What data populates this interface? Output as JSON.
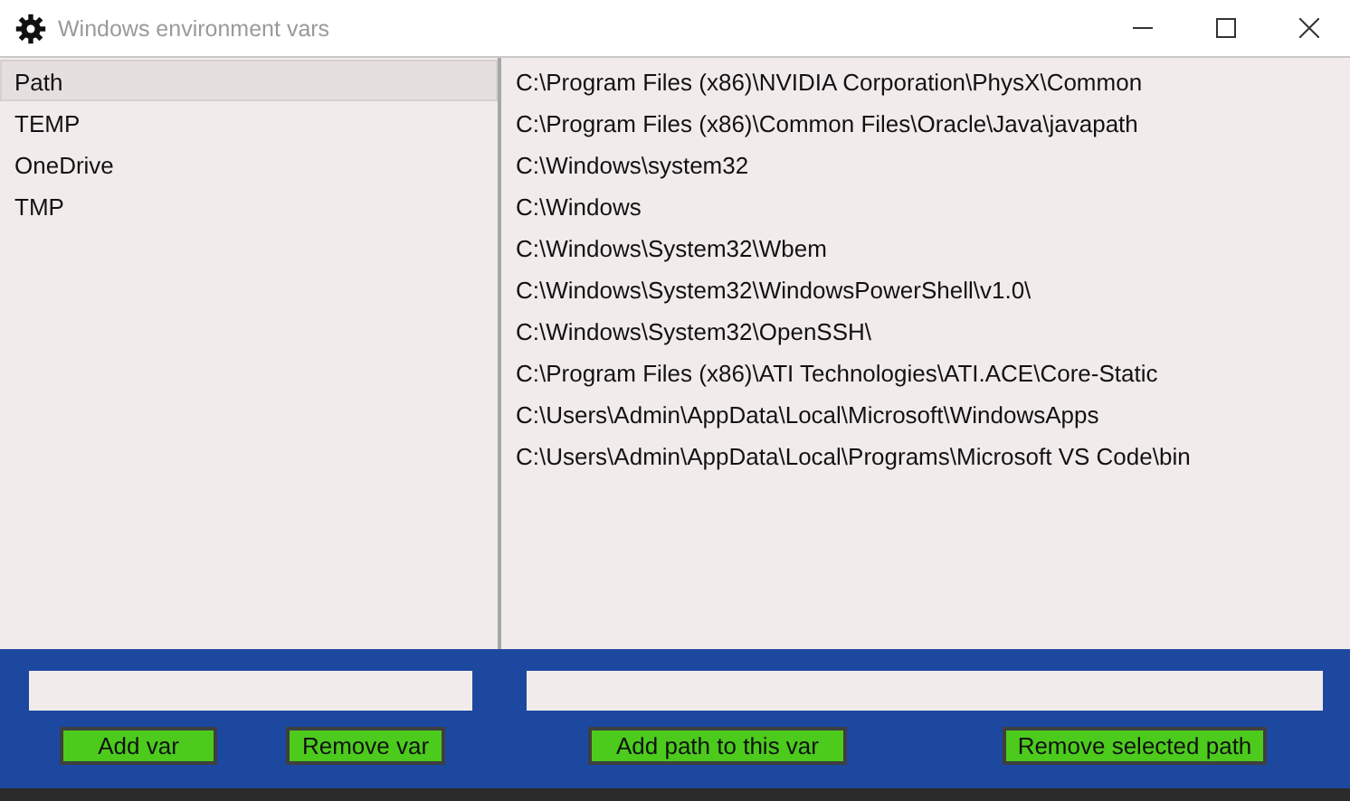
{
  "window": {
    "title": "Windows environment vars"
  },
  "variables": [
    {
      "name": "Path",
      "selected": true
    },
    {
      "name": "TEMP",
      "selected": false
    },
    {
      "name": "OneDrive",
      "selected": false
    },
    {
      "name": "TMP",
      "selected": false
    }
  ],
  "paths": [
    {
      "value": "C:\\Program Files (x86)\\NVIDIA Corporation\\PhysX\\Common",
      "selected": false
    },
    {
      "value": "C:\\Program Files (x86)\\Common Files\\Oracle\\Java\\javapath",
      "selected": false
    },
    {
      "value": "C:\\Windows\\system32",
      "selected": false
    },
    {
      "value": "C:\\Windows",
      "selected": false
    },
    {
      "value": "C:\\Windows\\System32\\Wbem",
      "selected": false
    },
    {
      "value": "C:\\Windows\\System32\\WindowsPowerShell\\v1.0\\",
      "selected": false
    },
    {
      "value": "C:\\Windows\\System32\\OpenSSH\\",
      "selected": false
    },
    {
      "value": "C:\\Program Files (x86)\\ATI Technologies\\ATI.ACE\\Core-Static",
      "selected": false
    },
    {
      "value": "C:\\Users\\Admin\\AppData\\Local\\Microsoft\\WindowsApps",
      "selected": false
    },
    {
      "value": "C:\\Users\\Admin\\AppData\\Local\\Programs\\Microsoft VS Code\\bin",
      "selected": false
    }
  ],
  "var_buttons": [
    "Add var",
    "Remove var"
  ],
  "path_buttons": [
    "Add path to this var",
    "Remove selected path"
  ]
}
